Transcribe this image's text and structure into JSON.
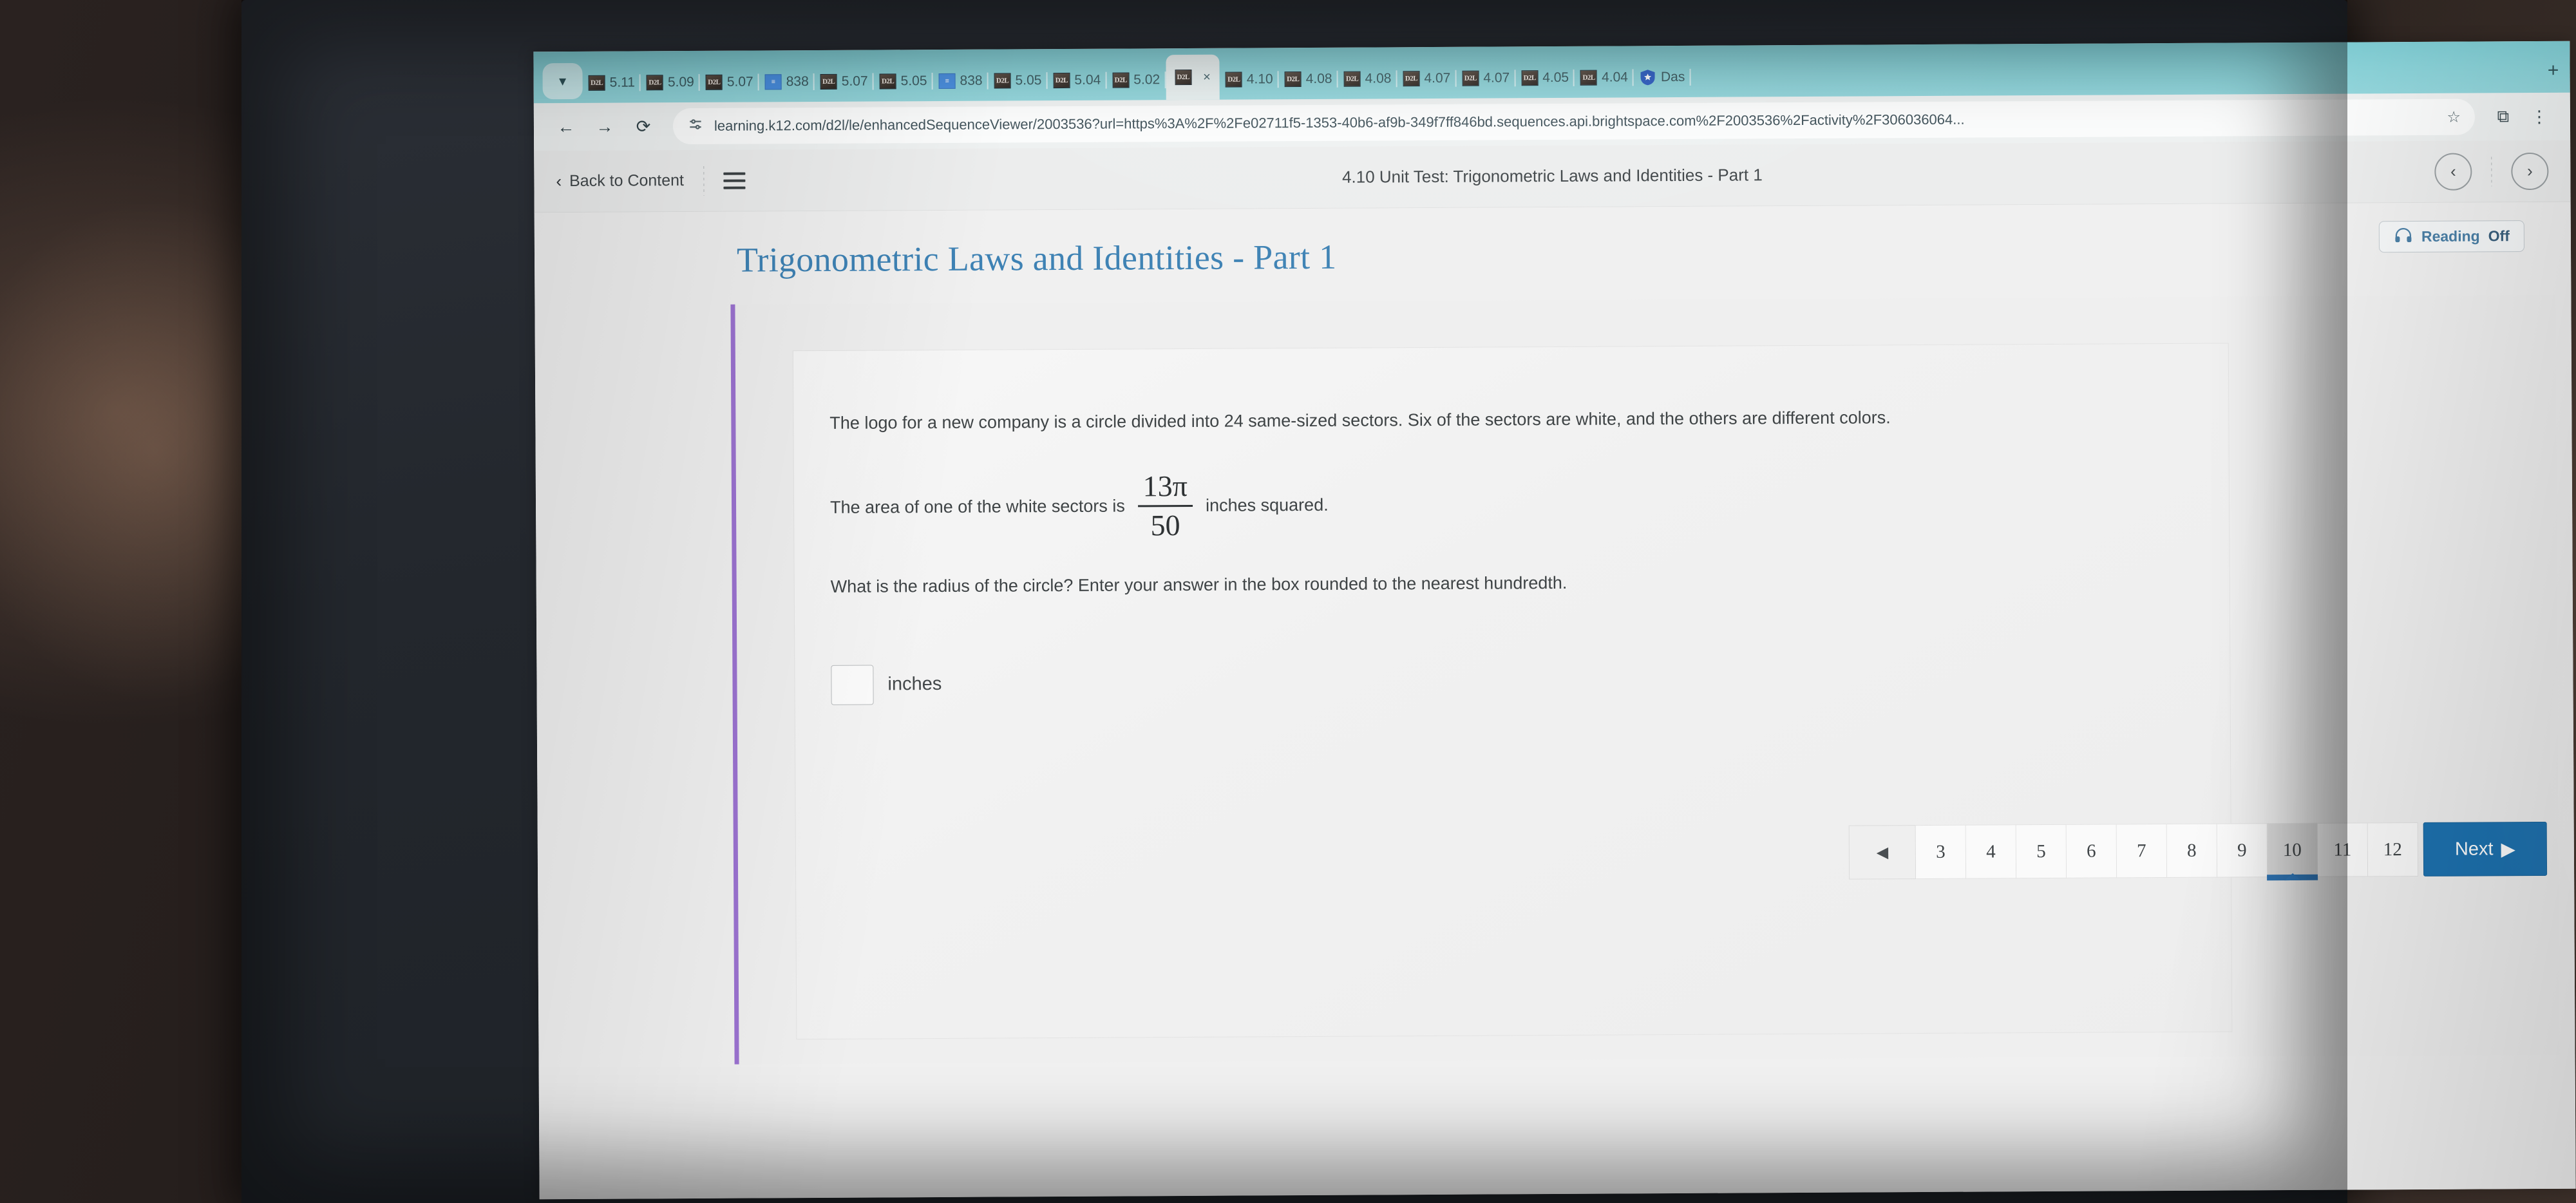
{
  "browser": {
    "tab_list_icon": "chevron-down-icon",
    "new_tab_label": "+",
    "tabs": [
      {
        "favicon": "d2l-icon",
        "title": "5.11"
      },
      {
        "favicon": "d2l-icon",
        "title": "5.09"
      },
      {
        "favicon": "d2l-icon",
        "title": "5.07"
      },
      {
        "favicon": "doc-icon",
        "title": "838"
      },
      {
        "favicon": "d2l-icon",
        "title": "5.07"
      },
      {
        "favicon": "d2l-icon",
        "title": "5.05"
      },
      {
        "favicon": "doc-icon",
        "title": "838"
      },
      {
        "favicon": "d2l-icon",
        "title": "5.05"
      },
      {
        "favicon": "d2l-icon",
        "title": "5.04"
      },
      {
        "favicon": "d2l-icon",
        "title": "5.02"
      },
      {
        "favicon": "d2l-icon",
        "title": "",
        "active": true,
        "close": "×"
      },
      {
        "favicon": "d2l-icon",
        "title": "4.10"
      },
      {
        "favicon": "d2l-icon",
        "title": "4.08"
      },
      {
        "favicon": "d2l-icon",
        "title": "4.08"
      },
      {
        "favicon": "d2l-icon",
        "title": "4.07"
      },
      {
        "favicon": "d2l-icon",
        "title": "4.07"
      },
      {
        "favicon": "d2l-icon",
        "title": "4.05"
      },
      {
        "favicon": "d2l-icon",
        "title": "4.04"
      },
      {
        "favicon": "shield-icon",
        "title": "Das"
      }
    ],
    "toolbar": {
      "back": "←",
      "forward": "→",
      "reload": "⟳",
      "site_info_icon": "tune-icon",
      "url": "learning.k12.com/d2l/le/enhancedSequenceViewer/2003536?url=https%3A%2F%2Fe02711f5-1353-40b6-af9b-349f7ff846bd.sequences.api.brightspace.com%2F2003536%2Factivity%2F306036064...",
      "bookmark_icon": "☆",
      "extensions_icon": "⧉",
      "menu_icon": "⋮"
    }
  },
  "app_header": {
    "back_label": "Back to Content",
    "back_chevron": "‹",
    "menu_icon": "hamburger-icon",
    "title": "4.10 Unit Test: Trigonometric Laws and Identities - Part 1",
    "prev_icon": "‹",
    "next_icon": "›",
    "overflow_icon": "⋮"
  },
  "content": {
    "page_title": "Trigonometric Laws and Identities - Part 1",
    "reading": {
      "icon": "headphones-icon",
      "label": "Reading",
      "state": "Off"
    },
    "question": {
      "paragraph1": "The logo for a new company is a circle divided into 24 same-sized sectors. Six of the sectors are white, and the others are different colors.",
      "line2_before": "The area of one of the white sectors is",
      "fraction_numerator": "13π",
      "fraction_denominator": "50",
      "line2_after": "inches squared.",
      "paragraph3": "What is the radius of the circle? Enter your answer in the box rounded to the nearest hundredth.",
      "answer_value": "",
      "answer_unit": "inches"
    },
    "pagination": {
      "prev_icon": "◀",
      "pages": [
        "3",
        "4",
        "5",
        "6",
        "7",
        "8",
        "9",
        "10",
        "11",
        "12"
      ],
      "current": "10",
      "next_label": "Next",
      "next_icon": "▶"
    }
  },
  "colors": {
    "tab_strip": "#8ad2d8",
    "accent_purple": "#9b72d0",
    "title_blue": "#3e82b4",
    "next_button_blue": "#1d72b0"
  }
}
